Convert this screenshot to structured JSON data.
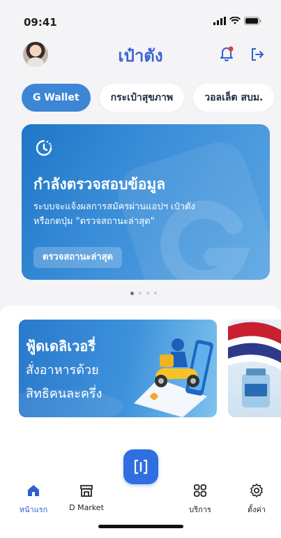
{
  "status": {
    "time": "09:41"
  },
  "header": {
    "title": "เป๋าตัง"
  },
  "chips": [
    {
      "label": "G Wallet",
      "active": true
    },
    {
      "label": "กระเป๋าสุขภาพ",
      "active": false
    },
    {
      "label": "วอลเล็ต สบม.",
      "active": false
    }
  ],
  "banner": {
    "title": "กำลังตรวจสอบข้อมูล",
    "desc_line1": "ระบบจะแจ้งผลการสมัครผ่านแอปฯ เป๋าตัง",
    "desc_line2": "หรือกดปุ่ม \"ตรวจสถานะล่าสุด\"",
    "button": "ตรวจสถานะล่าสุด"
  },
  "pager": {
    "count": 4,
    "active": 0
  },
  "promo": {
    "line1": "ฟู้ดเดลิเวอรี่",
    "line2": "สั่งอาหารด้วย",
    "line3": "สิทธิคนละครึ่ง"
  },
  "nav": {
    "home": "หน้าแรก",
    "market": "D Market",
    "services": "บริการ",
    "settings": "ตั้งค่า"
  },
  "colors": {
    "accent": "#2f6fe0",
    "chip_active": "#3d86d6",
    "title": "#3b63d8"
  }
}
